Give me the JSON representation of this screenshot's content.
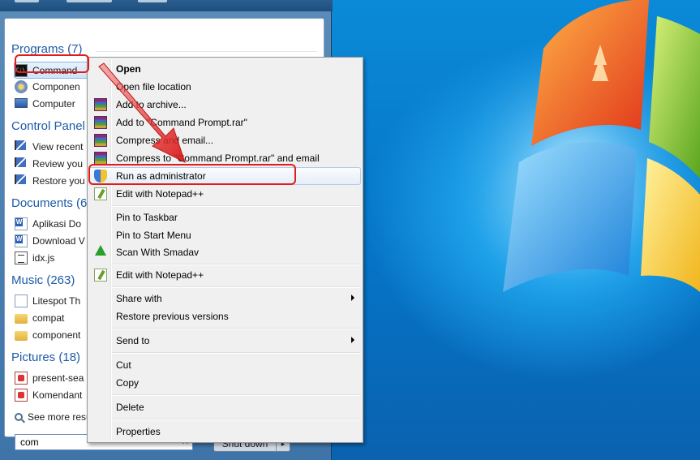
{
  "start_menu": {
    "groups": [
      {
        "header": "Programs (7)",
        "items": [
          "Command",
          "Componen",
          "Computer"
        ]
      },
      {
        "header": "Control Panel",
        "items": [
          "View recent",
          "Review you",
          "Restore you"
        ]
      },
      {
        "header": "Documents (6",
        "items": [
          "Aplikasi Do",
          "Download V",
          "idx.js"
        ]
      },
      {
        "header": "Music (263)",
        "items": [
          "Litespot Th",
          "compat",
          "component"
        ]
      },
      {
        "header": "Pictures (18)",
        "items": [
          "present-sea",
          "Komendant"
        ]
      }
    ],
    "see_more": "See more resu",
    "search_value": "com",
    "search_clear": "✕",
    "shutdown_label": "Shut down",
    "shutdown_arrow": "▸"
  },
  "context_menu": {
    "items": [
      {
        "label": "Open",
        "icon": "none"
      },
      {
        "label": "Open file location",
        "icon": "none"
      },
      {
        "label": "Add to archive...",
        "icon": "winrar-icon"
      },
      {
        "label": "Add to \"Command Prompt.rar\"",
        "icon": "winrar-icon"
      },
      {
        "label": "Compress and email...",
        "icon": "winrar-icon"
      },
      {
        "label": "Compress to \"Command Prompt.rar\" and email",
        "icon": "winrar-icon"
      },
      {
        "label": "Run as administrator",
        "icon": "uac-shield-icon"
      },
      {
        "label": "Edit with Notepad++",
        "icon": "notepadpp-icon"
      },
      {
        "label": "Pin to Taskbar",
        "icon": "none"
      },
      {
        "label": "Pin to Start Menu",
        "icon": "none"
      },
      {
        "label": "Scan With Smadav",
        "icon": "smadav-icon"
      },
      {
        "label": "Edit with Notepad++",
        "icon": "notepadpp-icon"
      },
      {
        "label": "Share with",
        "icon": "none"
      },
      {
        "label": "Restore previous versions",
        "icon": "none"
      },
      {
        "label": "Send to",
        "icon": "none"
      },
      {
        "label": "Cut",
        "icon": "none"
      },
      {
        "label": "Copy",
        "icon": "none"
      },
      {
        "label": "Delete",
        "icon": "none"
      },
      {
        "label": "Properties",
        "icon": "none"
      }
    ]
  },
  "colors": {
    "annotation_red": "#e21b1b",
    "group_header_blue": "#1e5aa8"
  }
}
